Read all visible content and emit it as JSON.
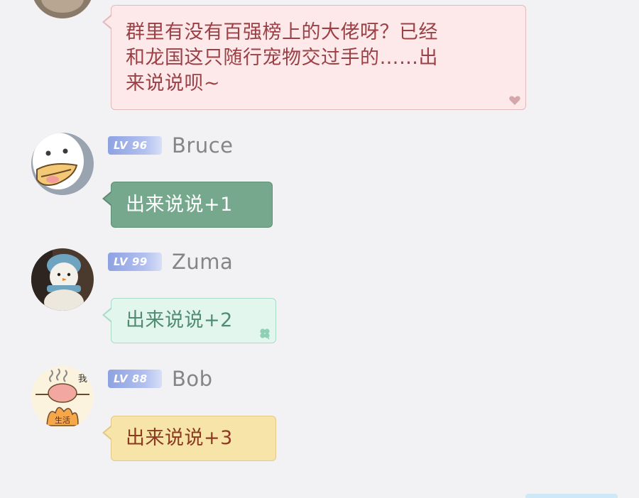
{
  "colors": {
    "background": "#f2f2f5",
    "pink_bubble": "#fde8ea",
    "pink_text": "#9b4044",
    "green_bubble": "#76a88e",
    "mint_bubble": "#e2f6ee",
    "mint_text": "#4f8c73",
    "yellow_bubble": "#f7e4a8",
    "yellow_text": "#8b3a1f",
    "level_badge": "#8ea2e2"
  },
  "messages": [
    {
      "avatar": "partial-avatar",
      "text": "群里有没有百强榜上的大佬呀？已经和龙国这只随行宠物交过手的……出来说说呗~",
      "lines": [
        "群里有没有百强榜上的大佬呀？已经",
        "和龙国这只随行宠物交过手的……出",
        "来说说呗~"
      ],
      "bubble_decoration": "heart-icon"
    },
    {
      "level": "LV 96",
      "username": "Bruce",
      "avatar": "duck-avatar",
      "text": "出来说说+1"
    },
    {
      "level": "LV 99",
      "username": "Zuma",
      "avatar": "snowman-avatar",
      "text": "出来说说+2",
      "bubble_decoration": "clover-icon"
    },
    {
      "level": "LV 88",
      "username": "Bob",
      "avatar": "grilled-pig-avatar",
      "avatar_text": [
        "我",
        "生活"
      ],
      "text": "出来说说+3"
    }
  ]
}
